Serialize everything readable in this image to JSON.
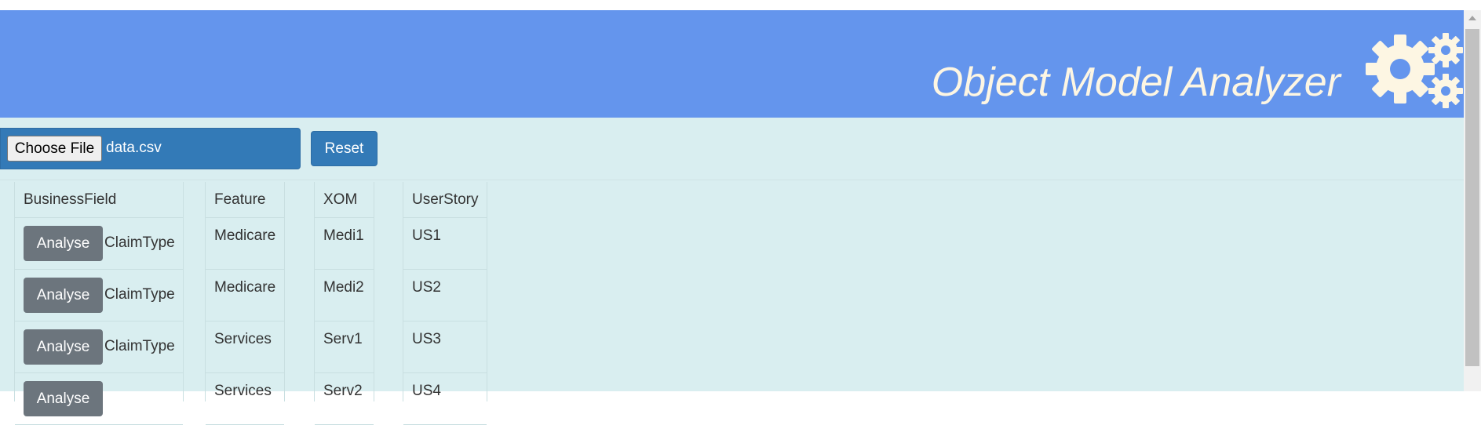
{
  "header": {
    "title": "Object Model Analyzer",
    "icon": "gears-icon",
    "color": "#6495ed",
    "title_color": "#fdf6e3"
  },
  "file_input": {
    "button_label": "Choose File",
    "file_name": "data.csv"
  },
  "toolbar": {
    "reset_label": "Reset"
  },
  "table": {
    "columns": [
      "BusinessField",
      "Feature",
      "XOM",
      "UserStory"
    ],
    "analyse_label": "Analyse",
    "rows": [
      {
        "business_field": "ClaimType",
        "feature": "Medicare",
        "xom": "Medi1",
        "user_story": "US1"
      },
      {
        "business_field": "ClaimType",
        "feature": "Medicare",
        "xom": "Medi2",
        "user_story": "US2"
      },
      {
        "business_field": "ClaimType",
        "feature": "Services",
        "xom": "Serv1",
        "user_story": "US3"
      },
      {
        "business_field": "",
        "feature": "Services",
        "xom": "Serv2",
        "user_story": "US4"
      }
    ]
  }
}
